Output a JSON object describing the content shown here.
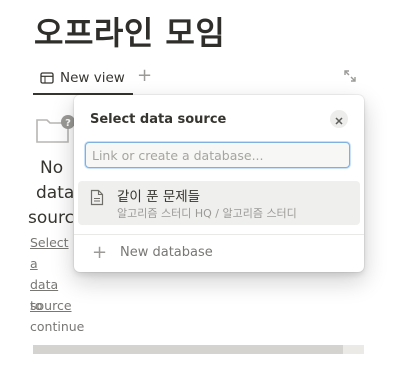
{
  "page": {
    "title": "오프라인 모임"
  },
  "tabs": {
    "active_label": "New view",
    "add_icon": "plus-icon",
    "expand_icon": "expand-icon"
  },
  "empty_state": {
    "heading_lines": [
      "No",
      "data",
      "source"
    ],
    "link_lines": [
      "Select a",
      "data",
      "source"
    ],
    "suffix_lines": [
      "to",
      "continue"
    ]
  },
  "popup": {
    "title": "Select data source",
    "search_placeholder": "Link or create a database...",
    "results": [
      {
        "name": "같이 푼 문제들",
        "path": "알고리즘 스터디 HQ / 알고리즘 스터디"
      }
    ],
    "new_database_label": "New database"
  },
  "colors": {
    "accent": "#2383e2",
    "text": "#37352f",
    "muted": "#9b9a97",
    "hover": "#efefee"
  }
}
